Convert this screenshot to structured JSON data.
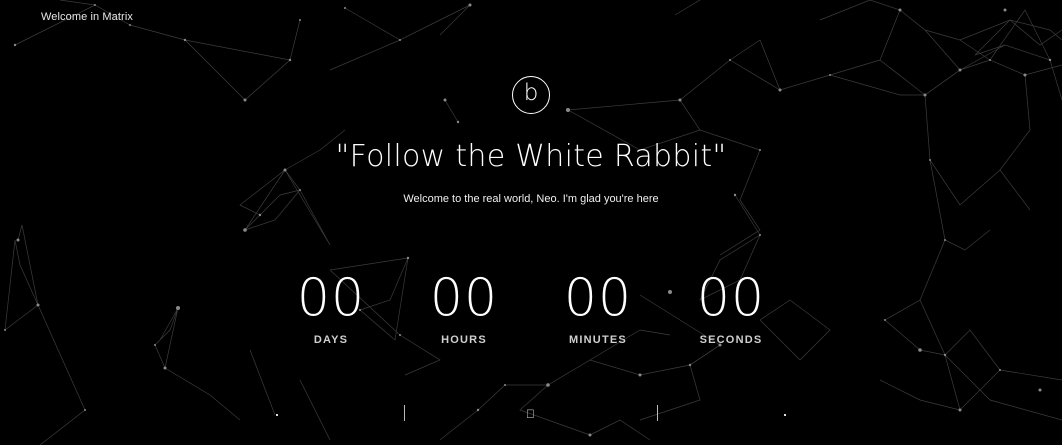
{
  "header": {
    "site_name": "Welcome in Matrix"
  },
  "logo": {
    "letter": "b"
  },
  "hero": {
    "headline": "\"Follow the White Rabbit\"",
    "subtitle": "Welcome to the real world, Neo. I'm glad you're here"
  },
  "countdown": {
    "units": [
      {
        "value": "00",
        "label": "DAYS"
      },
      {
        "value": "00",
        "label": "HOURS"
      },
      {
        "value": "00",
        "label": "MINUTES"
      },
      {
        "value": "00",
        "label": "SECONDS"
      }
    ]
  },
  "footer": {
    "icon": "apple-icon"
  },
  "colors": {
    "background": "#000000",
    "text": "#ffffff",
    "network_lines": "#3a3a3a",
    "network_nodes": "#8a8a8a"
  }
}
